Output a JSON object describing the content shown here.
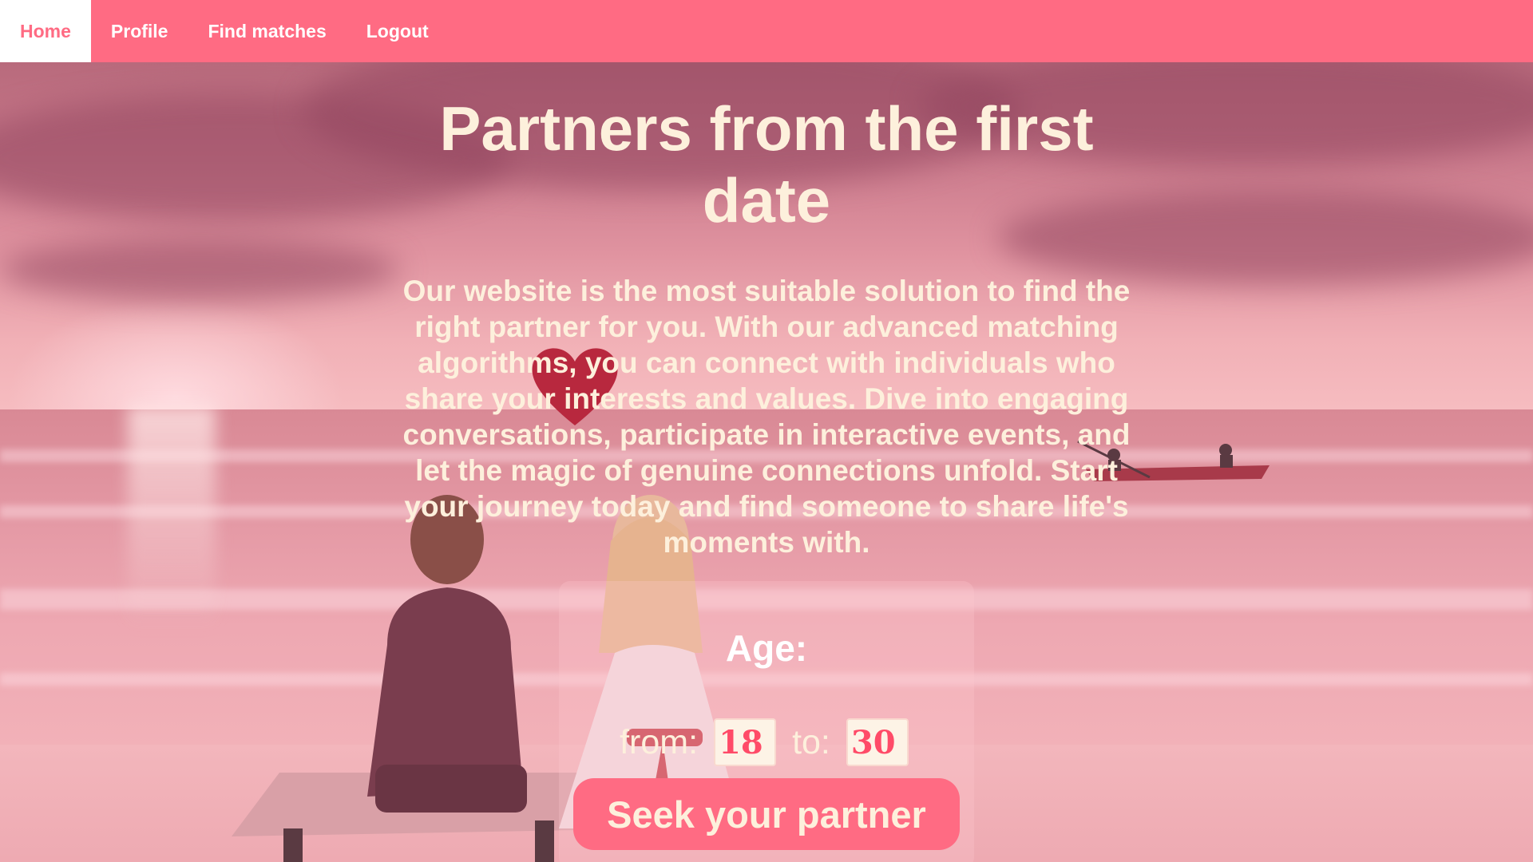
{
  "nav": {
    "items": [
      {
        "label": "Home",
        "active": true
      },
      {
        "label": "Profile",
        "active": false
      },
      {
        "label": "Find matches",
        "active": false
      },
      {
        "label": "Logout",
        "active": false
      }
    ]
  },
  "hero": {
    "title": "Partners from the first date",
    "description": "Our website is the most suitable solution to find the right partner for you. With our advanced matching algorithms, you can connect with individuals who share your interests and values. Dive into engaging conversations, participate in interactive events, and let the magic of genuine connections unfold. Start your journey today and find someone to share life's moments with."
  },
  "search": {
    "age_label": "Age:",
    "from_label": "from:",
    "from_value": "18",
    "to_label": "to:",
    "to_value": "30",
    "button_label": "Seek your partner"
  },
  "colors": {
    "accent": "#ff6b83",
    "text_light": "#fdf0dc"
  }
}
